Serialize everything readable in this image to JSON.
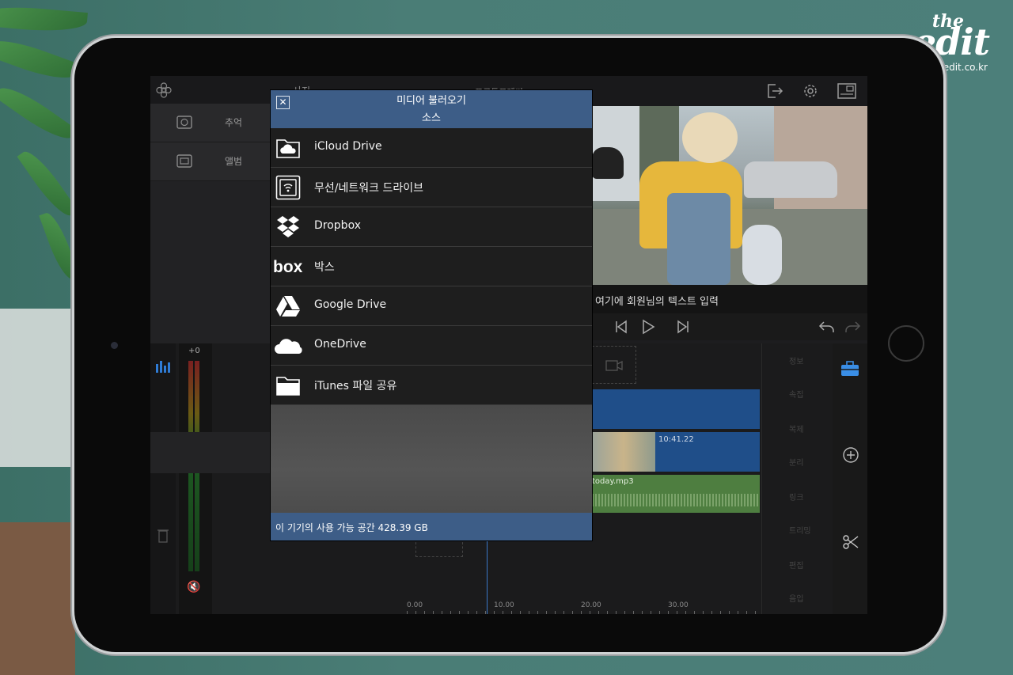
{
  "watermark": {
    "brand_top": "the",
    "brand_bottom": "edit",
    "url": "the-edit.co.kr"
  },
  "app": {
    "topbar_tab": "사진",
    "topbar_project": "프로듀프레씨",
    "left_panel": [
      {
        "label": "추억",
        "icon": "memories-icon"
      },
      {
        "label": "앨범",
        "icon": "album-icon"
      }
    ],
    "preview_caption": "여기에 회원님의 텍스트 입력",
    "volume_label": "+0",
    "timeline_clip_time": "10:41.22",
    "timeline_audio_label": "today.mp3",
    "timeline_ticks": [
      "0.00",
      "10.00",
      "20.00",
      "30.00"
    ],
    "right_menu": [
      "정보",
      "속집",
      "복제",
      "분리",
      "링크",
      "트리밍",
      "편집",
      "음입"
    ]
  },
  "modal": {
    "title": "미디어 불러오기",
    "subtitle": "소스",
    "close_icon": "close-icon",
    "sources": [
      {
        "label": "iCloud Drive",
        "icon": "icloud-folder-icon"
      },
      {
        "label": "무선/네트워크 드라이브",
        "icon": "wifi-drive-icon"
      },
      {
        "label": "Dropbox",
        "icon": "dropbox-icon"
      },
      {
        "label": "박스",
        "icon": "box-icon"
      },
      {
        "label": "Google Drive",
        "icon": "google-drive-icon"
      },
      {
        "label": "OneDrive",
        "icon": "onedrive-icon"
      },
      {
        "label": "iTunes 파일 공유",
        "icon": "folder-icon"
      }
    ],
    "footer": "이 기기의 사용 가능 공간 428.39 GB"
  },
  "colors": {
    "modal_header": "#3d5d87",
    "timeline_blue": "#1f4e89",
    "timeline_green": "#4e7e40",
    "accent_icon": "#3a8ee6"
  }
}
